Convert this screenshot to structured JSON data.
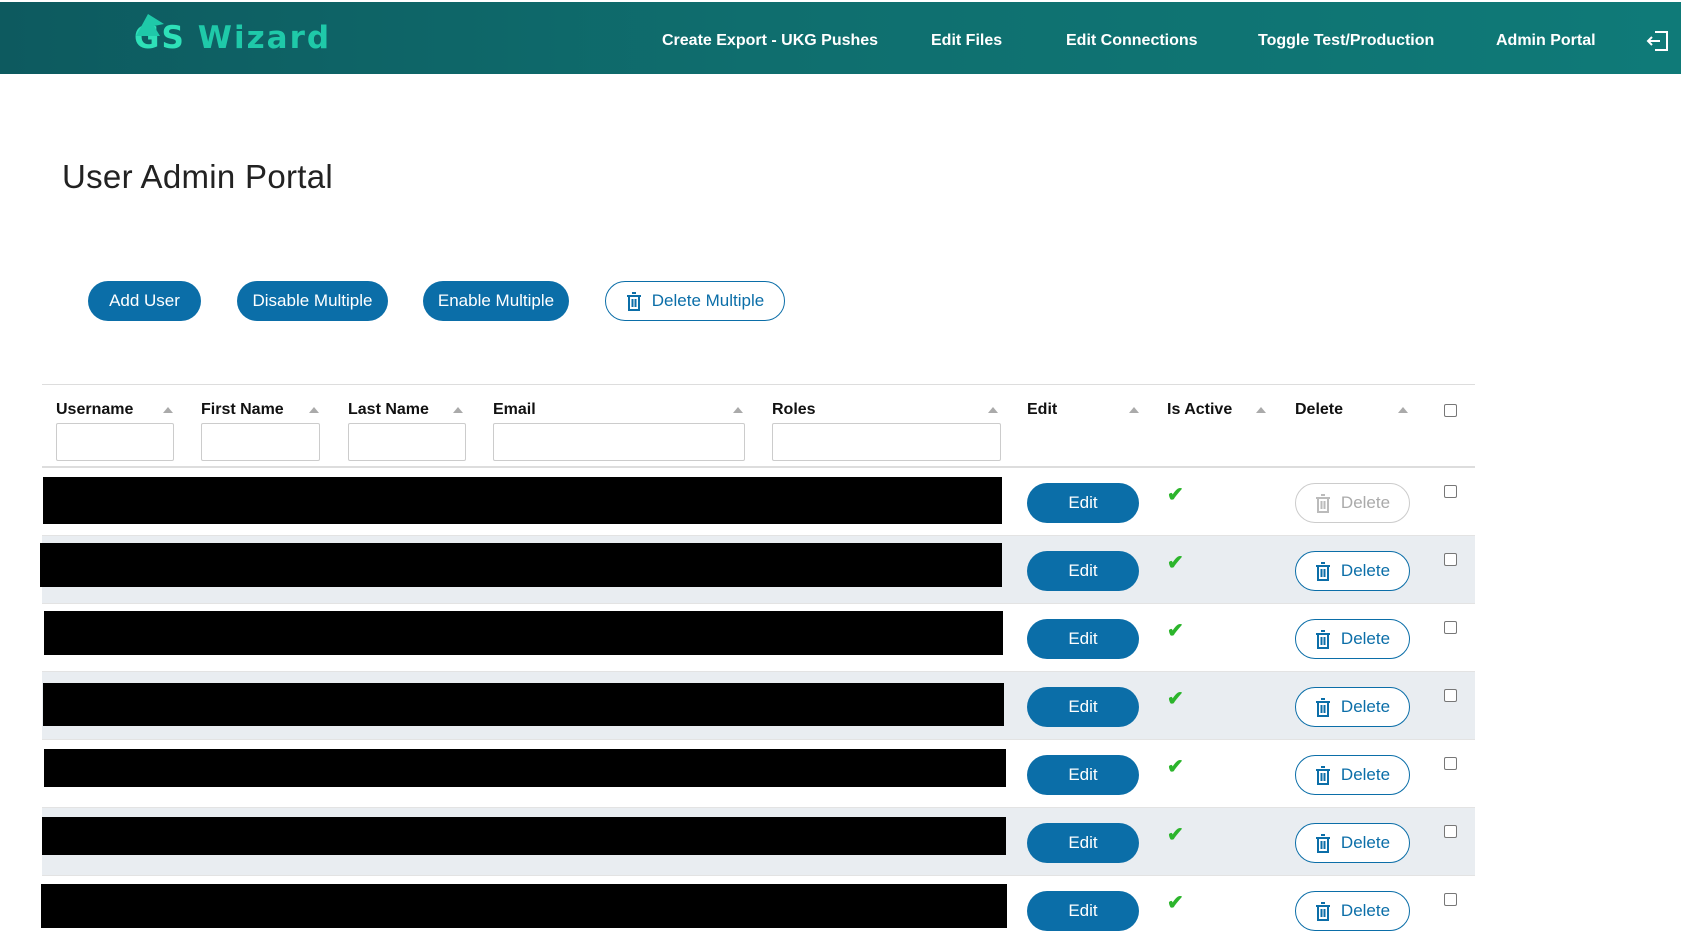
{
  "app": {
    "name": "GS Wizard",
    "logo_gs": "GS",
    "logo_word": "Wizard"
  },
  "nav": {
    "create_export": "Create Export - UKG Pushes",
    "edit_files": "Edit Files",
    "edit_connections": "Edit Connections",
    "toggle": "Toggle Test/Production",
    "admin_portal": "Admin Portal",
    "logout_icon": "logout-icon"
  },
  "page": {
    "title": "User Admin Portal"
  },
  "actions": {
    "add_user": "Add User",
    "disable_multiple": "Disable Multiple",
    "enable_multiple": "Enable Multiple",
    "delete_multiple": "Delete Multiple"
  },
  "table": {
    "columns": {
      "username": "Username",
      "first_name": "First Name",
      "last_name": "Last Name",
      "email": "Email",
      "roles": "Roles",
      "edit": "Edit",
      "is_active": "Is Active",
      "delete": "Delete"
    },
    "rows": [
      {
        "edit": "Edit",
        "active": "✔",
        "delete": "Delete",
        "delete_enabled": false
      },
      {
        "edit": "Edit",
        "active": "✔",
        "delete": "Delete",
        "delete_enabled": true
      },
      {
        "edit": "Edit",
        "active": "✔",
        "delete": "Delete",
        "delete_enabled": true
      },
      {
        "edit": "Edit",
        "active": "✔",
        "delete": "Delete",
        "delete_enabled": true
      },
      {
        "edit": "Edit",
        "active": "✔",
        "delete": "Delete",
        "delete_enabled": true
      },
      {
        "edit": "Edit",
        "active": "✔",
        "delete": "Delete",
        "delete_enabled": true
      },
      {
        "edit": "Edit",
        "active": "✔",
        "delete": "Delete",
        "delete_enabled": true
      }
    ]
  },
  "colors": {
    "nav_start": "#0d5a5f",
    "nav_end": "#0f7a78",
    "primary": "#0b6ea8",
    "active_check": "#2cb52c",
    "alt_row": "#e9edf1"
  }
}
